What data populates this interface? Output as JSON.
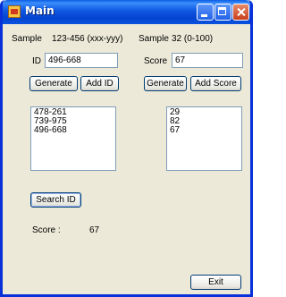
{
  "window": {
    "title": "Main"
  },
  "left": {
    "sample_label": "Sample",
    "sample_value": "123-456 (xxx-yyy)",
    "id_label": "ID",
    "id_value": "496-668",
    "generate_label": "Generate",
    "add_label": "Add ID",
    "list_items": [
      "478-261",
      "739-975",
      "496-668"
    ]
  },
  "right": {
    "sample_label": "Sample",
    "sample_value": "32 (0-100)",
    "score_label": "Score",
    "score_value": "67",
    "generate_label": "Generate",
    "add_label": "Add Score",
    "list_items": [
      "29",
      "82",
      "67"
    ]
  },
  "search": {
    "button_label": "Search ID",
    "result_label": "Score :",
    "result_value": "67"
  },
  "footer": {
    "exit_label": "Exit"
  }
}
